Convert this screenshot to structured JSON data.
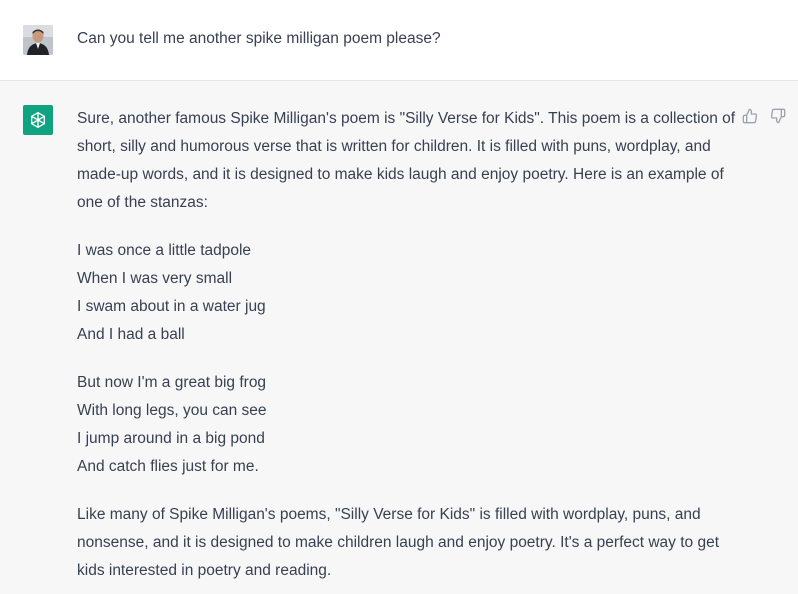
{
  "user": {
    "message": "Can you tell me another spike milligan poem please?",
    "avatar_icon": "user-photo-avatar"
  },
  "assistant": {
    "avatar_icon": "openai-logo-icon",
    "avatar_color": "#10a37f",
    "intro": "Sure, another famous Spike Milligan's poem is \"Silly Verse for Kids\". This poem is a collection of short, silly and humorous verse that is written for children. It is filled with puns, wordplay, and made-up words, and it is designed to make kids laugh and enjoy poetry. Here is an example of one of the stanzas:",
    "stanza1": {
      "line1": "I was once a little tadpole",
      "line2": "When I was very small",
      "line3": "I swam about in a water jug",
      "line4": "And I had a ball"
    },
    "stanza2": {
      "line1": "But now I'm a great big frog",
      "line2": "With long legs, you can see",
      "line3": "I jump around in a big pond",
      "line4": "And catch flies just for me."
    },
    "outro": "Like many of Spike Milligan's poems, \"Silly Verse for Kids\" is filled with wordplay, puns, and nonsense, and it is designed to make children laugh and enjoy poetry. It's a perfect way to get kids interested in poetry and reading."
  },
  "feedback": {
    "thumbs_up_icon": "thumbs-up-icon",
    "thumbs_down_icon": "thumbs-down-icon"
  },
  "colors": {
    "assistant_bg": "#f7f7f8",
    "text": "#374151",
    "divider": "#e5e7eb"
  }
}
